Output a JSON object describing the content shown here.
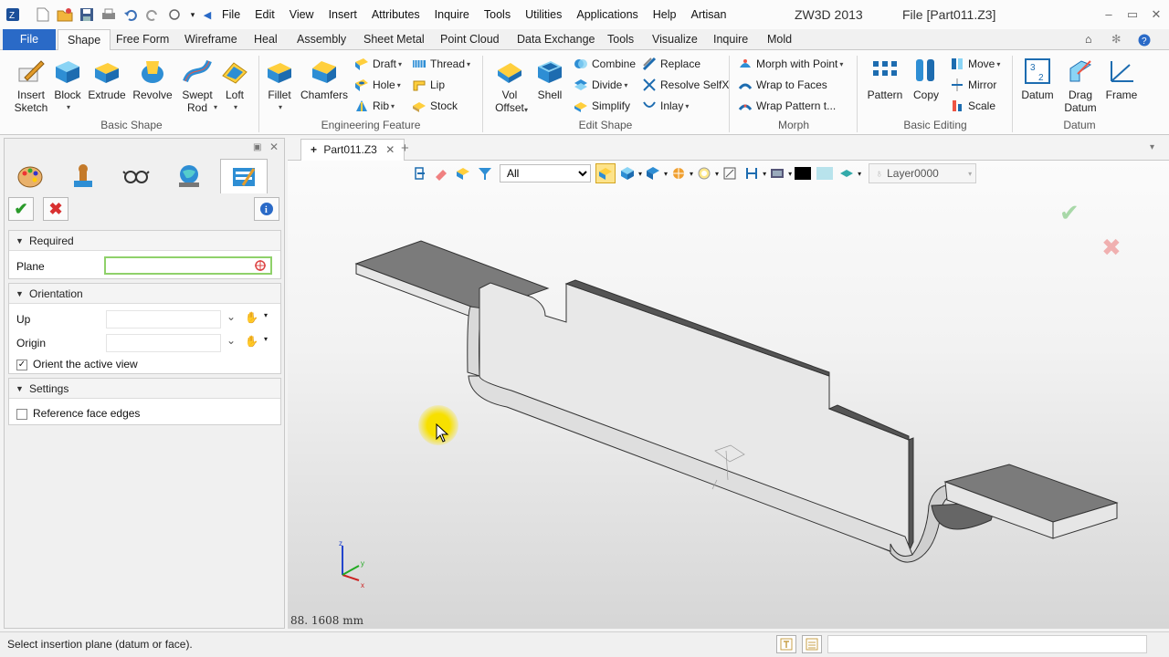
{
  "menu": {
    "items": [
      "File",
      "Edit",
      "View",
      "Insert",
      "Attributes",
      "Inquire",
      "Tools",
      "Utilities",
      "Applications",
      "Help",
      "Artisan"
    ]
  },
  "window": {
    "app_title": "ZW3D 2013",
    "file_title": "File [Part011.Z3]"
  },
  "ribbon_tabs": [
    "File",
    "Shape",
    "Free Form",
    "Wireframe",
    "Heal",
    "Assembly",
    "Sheet Metal",
    "Point Cloud",
    "Data Exchange",
    "Tools",
    "Visualize",
    "Inquire",
    "Mold"
  ],
  "active_tab": "Shape",
  "ribbon": {
    "basic_shape": {
      "label": "Basic Shape",
      "buttons": [
        "Insert\nSketch",
        "Block",
        "Extrude",
        "Revolve",
        "Swept\nRod",
        "Loft"
      ]
    },
    "engineering_feature": {
      "label": "Engineering Feature",
      "big": [
        "Fillet",
        "Chamfers"
      ],
      "small": [
        "Draft",
        "Thread",
        "Hole",
        "Lip",
        "Rib",
        "Stock"
      ]
    },
    "edit_shape": {
      "label": "Edit Shape",
      "big": [
        "Vol\nOffset",
        "Shell"
      ],
      "small": [
        "Combine",
        "Replace",
        "Divide",
        "Resolve SelfX",
        "Simplify",
        "Inlay"
      ]
    },
    "morph": {
      "label": "Morph",
      "small": [
        "Morph with Point",
        "Wrap to Faces",
        "Wrap Pattern t..."
      ]
    },
    "basic_editing": {
      "label": "Basic Editing",
      "big": [
        "Pattern",
        "Copy"
      ],
      "small": [
        "Move",
        "Mirror",
        "Scale"
      ]
    },
    "datum": {
      "label": "Datum",
      "big": [
        "Datum",
        "Drag\nDatum",
        "Frame"
      ]
    }
  },
  "panel": {
    "sections": {
      "required": "Required",
      "orientation": "Orientation",
      "settings": "Settings"
    },
    "fields": {
      "plane_label": "Plane",
      "up_label": "Up",
      "origin_label": "Origin"
    },
    "checkboxes": {
      "orient_view": "Orient the active view",
      "orient_view_checked": true,
      "reference_edges": "Reference face edges",
      "reference_edges_checked": false
    }
  },
  "document": {
    "tab_label": "Part011.Z3"
  },
  "viewport": {
    "filter_value": "All",
    "layer": "Layer0000",
    "measure": "88. 1608 mm"
  },
  "status": {
    "text": "Select insertion plane (datum or face)."
  },
  "colors": {
    "file_tab": "#2a6ac7",
    "accent_yellow": "#f7e000"
  }
}
